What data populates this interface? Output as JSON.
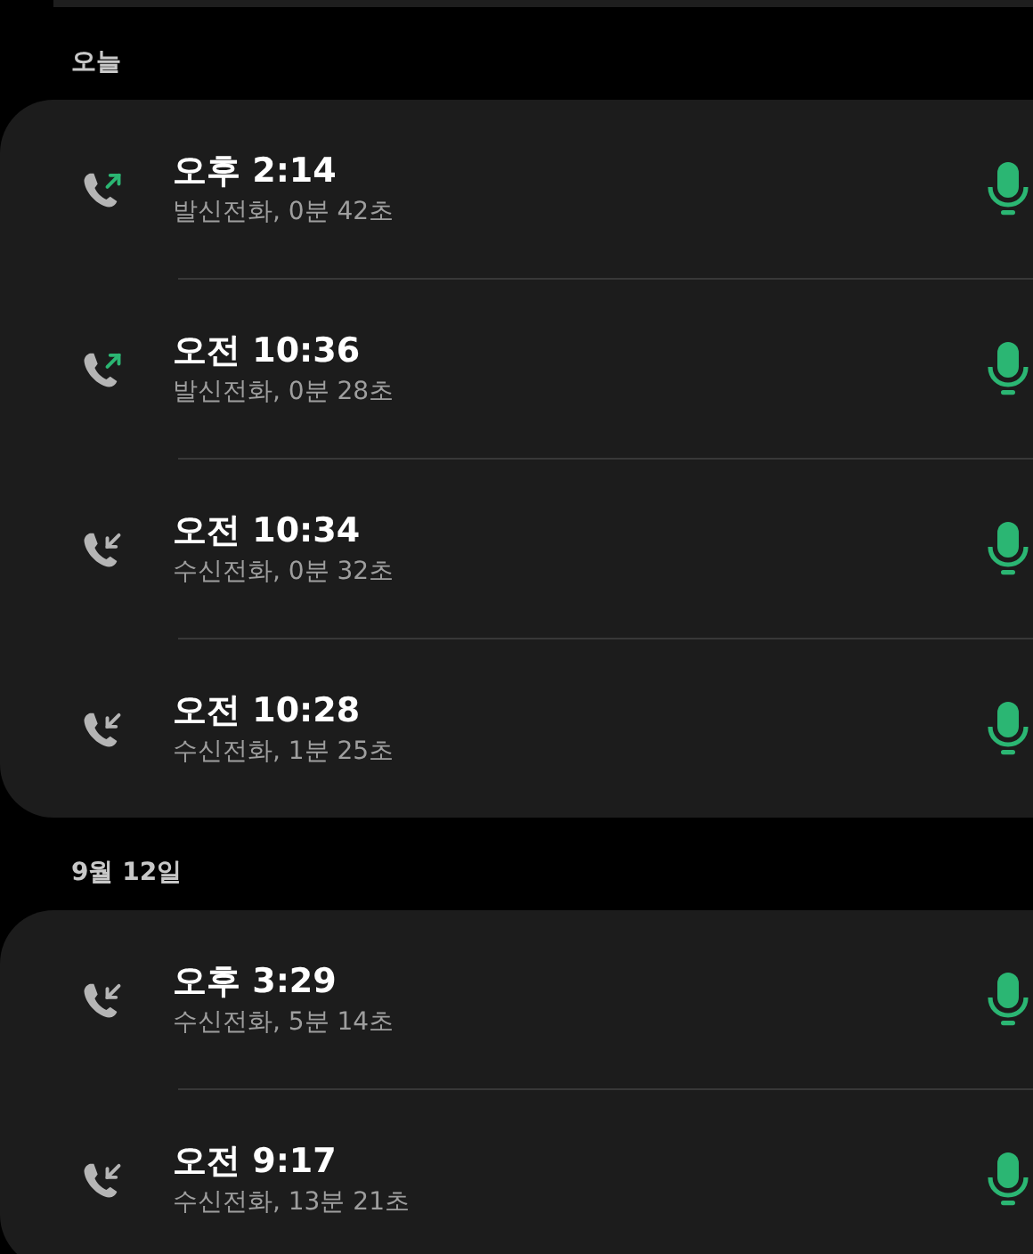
{
  "sections": [
    {
      "header": "오늘",
      "calls": [
        {
          "kind": "outgoing",
          "time": "오후 2:14",
          "detail": "발신전화, 0분 42초"
        },
        {
          "kind": "outgoing",
          "time": "오전 10:36",
          "detail": "발신전화, 0분 28초"
        },
        {
          "kind": "incoming",
          "time": "오전 10:34",
          "detail": "수신전화, 0분 32초"
        },
        {
          "kind": "incoming",
          "time": "오전 10:28",
          "detail": "수신전화, 1분 25초"
        }
      ]
    },
    {
      "header": "9월 12일",
      "calls": [
        {
          "kind": "incoming",
          "time": "오후 3:29",
          "detail": "수신전화, 5분 14초"
        },
        {
          "kind": "incoming",
          "time": "오전 9:17",
          "detail": "수신전화, 13분 21초"
        }
      ]
    }
  ]
}
